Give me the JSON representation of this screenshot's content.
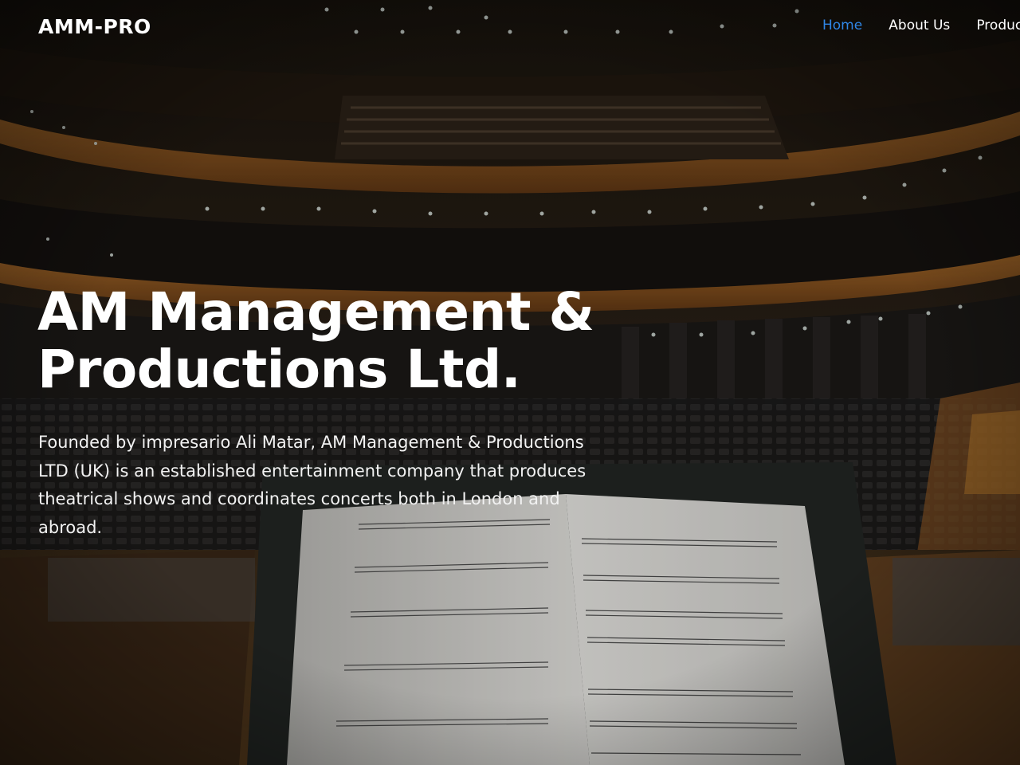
{
  "brand": {
    "logo_text": "AMM-PRO"
  },
  "nav": {
    "items": [
      {
        "label": "Home",
        "active": true
      },
      {
        "label": "About Us",
        "active": false
      },
      {
        "label": "Productions",
        "active": false
      }
    ]
  },
  "hero": {
    "title": "AM Management & Productions Ltd.",
    "description": "Founded by impresario Ali Matar, AM Management & Productions LTD (UK) is an established entertainment company that produces theatrical shows and coordinates concerts both in London and abroad.",
    "background_image": "concert hall interior with music stand and sheet music"
  },
  "colors": {
    "nav_active": "#2f86e6",
    "text": "#ffffff"
  }
}
